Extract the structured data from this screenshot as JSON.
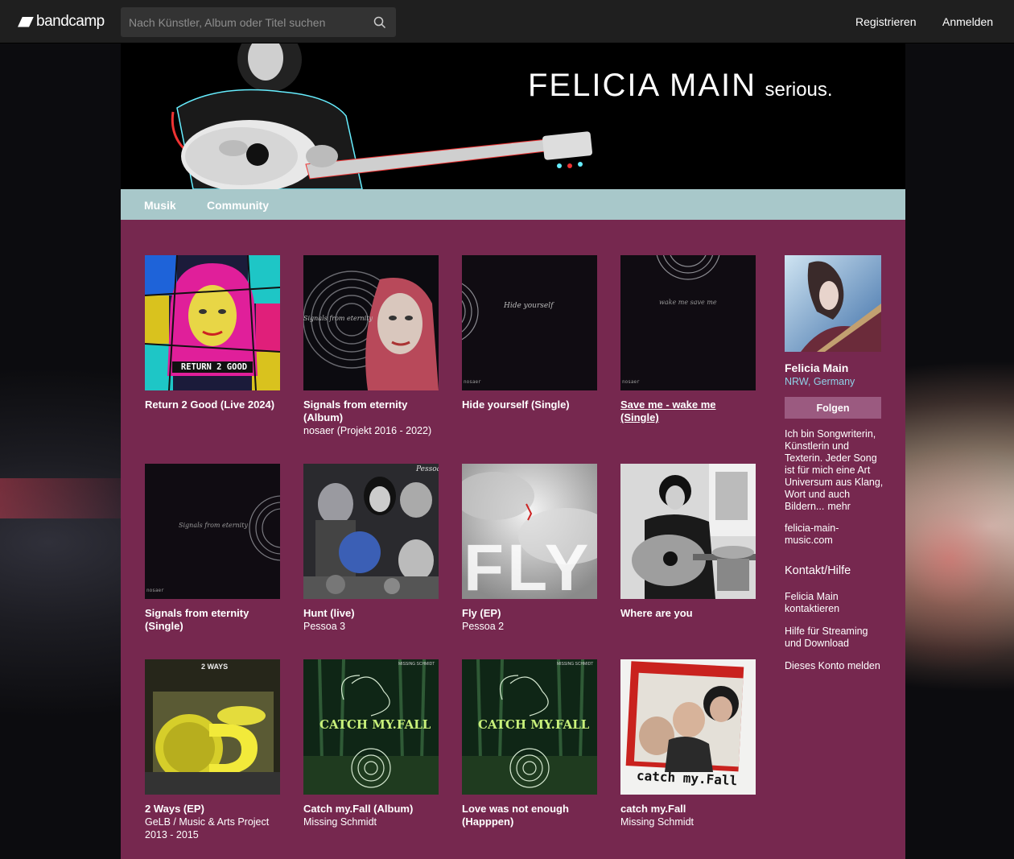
{
  "topbar": {
    "logo_text": "bandcamp",
    "search_placeholder": "Nach Künstler, Album oder Titel suchen",
    "register": "Registrieren",
    "login": "Anmelden"
  },
  "header": {
    "artist_name": "FELICIA MAIN",
    "tagline": "serious."
  },
  "nav": {
    "music": "Musik",
    "community": "Community"
  },
  "albums": [
    {
      "title": "Return 2 Good (Live 2024)",
      "artist": ""
    },
    {
      "title": "Signals from eternity (Album)",
      "artist": "nosaer (Projekt 2016 - 2022)"
    },
    {
      "title": "Hide yourself (Single)",
      "artist": ""
    },
    {
      "title": "Save me - wake me (Single)",
      "artist": ""
    },
    {
      "title": "Signals from eternity (Single)",
      "artist": ""
    },
    {
      "title": "Hunt (live)",
      "artist": "Pessoa 3"
    },
    {
      "title": "Fly (EP)",
      "artist": "Pessoa 2"
    },
    {
      "title": "Where are you",
      "artist": ""
    },
    {
      "title": "2 Ways (EP)",
      "artist": "GeLB / Music & Arts Project 2013 - 2015"
    },
    {
      "title": "Catch my.Fall (Album)",
      "artist": "Missing Schmidt"
    },
    {
      "title": "Love was not enough (Happpen)",
      "artist": ""
    },
    {
      "title": "catch my.Fall",
      "artist": "Missing Schmidt"
    }
  ],
  "cover_text": {
    "c1_art": "RETURN 2 GOOD",
    "c2_art": "Signals from eternity",
    "c3_art": "Hide yourself",
    "c3_label": "nosaer",
    "c4_art": "wake me  save me",
    "c4_label": "nosaer",
    "c5_art": "Signals from eternity",
    "c5_label": "nosaer",
    "c6_art": "Pessoa",
    "c7_art": "FLY",
    "c9_art": "2 WAYS",
    "c10_art": "CATCH MY.FALL",
    "c10_label": "MISSING SCHMIDT",
    "c11_art": "CATCH MY.FALL",
    "c11_label": "MISSING SCHMIDT",
    "c12_art": "catch my.Fall"
  },
  "sidebar": {
    "name": "Felicia Main",
    "location": "NRW, Germany",
    "follow": "Folgen",
    "bio": "Ich bin Songwriterin, Künstlerin und Texterin. Jeder Song ist für mich eine Art Universum aus Klang, Wort und auch Bildern...",
    "more": "mehr",
    "website": "felicia-main-music.com",
    "contact_heading": "Kontakt/Hilfe",
    "contact_artist": "Felicia Main kontaktieren",
    "help": "Hilfe für Streaming und Download",
    "report": "Dieses Konto melden"
  },
  "colors": {
    "panel": "#76284f",
    "nav": "#a8c8ca",
    "location": "#8fd2e8",
    "topbar": "#1f1f1f"
  }
}
